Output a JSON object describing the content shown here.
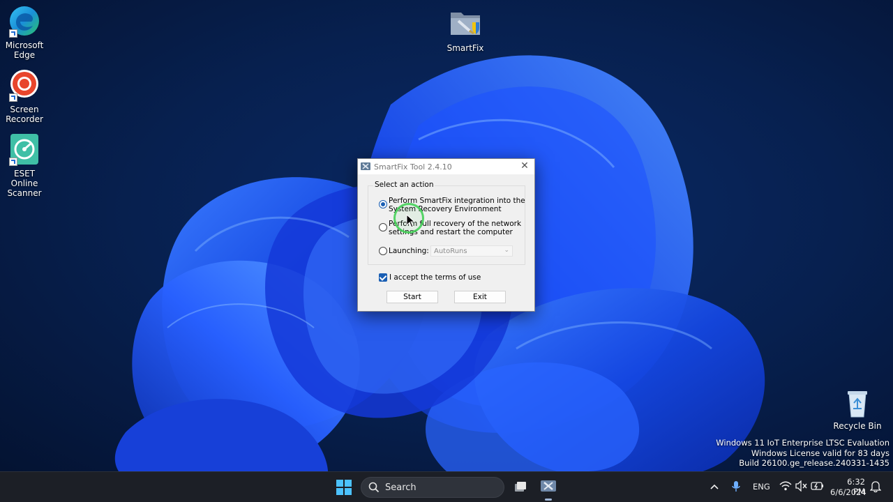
{
  "desktop": {
    "icons": [
      {
        "label": "Microsoft Edge",
        "icon": "edge-icon"
      },
      {
        "label": "Screen Recorder",
        "icon": "screen-recorder-icon"
      },
      {
        "label": "ESET Online Scanner",
        "icon": "eset-scanner-icon"
      },
      {
        "label": "SmartFix",
        "icon": "smartfix-folder-icon"
      },
      {
        "label": "Recycle Bin",
        "icon": "recycle-bin-icon"
      }
    ],
    "watermark": {
      "line1": "Windows 11 IoT Enterprise LTSC Evaluation",
      "line2": "Windows License valid for 83 days",
      "line3": "Build 26100.ge_release.240331-1435"
    }
  },
  "dialog": {
    "title": "SmartFix Tool 2.4.10",
    "group_label": "Select an action",
    "options": [
      {
        "line1": "Perform SmartFix integration into the",
        "line2": "System Recovery Environment",
        "selected": true
      },
      {
        "line1": "Perform full recovery of the network",
        "line2": "settings and restart the computer",
        "selected": false
      },
      {
        "line1": "Launching:",
        "selected": false
      }
    ],
    "launch_select": {
      "value": "AutoRuns"
    },
    "accept_terms": {
      "label": "I accept the terms of use",
      "checked": true
    },
    "buttons": {
      "start": "Start",
      "exit": "Exit"
    }
  },
  "taskbar": {
    "search_placeholder": "Search",
    "language": "ENG",
    "time": "6:32 PM",
    "date": "6/6/2024"
  },
  "colors": {
    "accent": "#1a5fb4",
    "taskbar": "#1c1f26",
    "wallpaper_dark": "#061a3d",
    "wallpaper_bloom": "#1f5cff"
  }
}
